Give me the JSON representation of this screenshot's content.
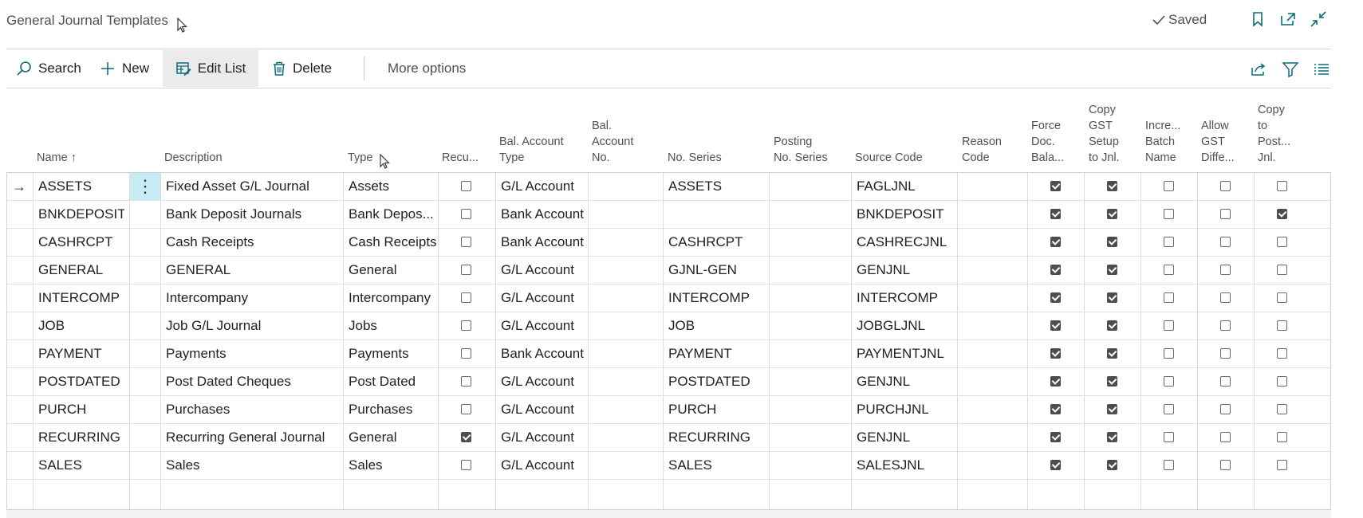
{
  "page": {
    "title": "General Journal Templates",
    "saved_label": "Saved"
  },
  "toolbar": {
    "search_label": "Search",
    "new_label": "New",
    "edit_list_label": "Edit List",
    "delete_label": "Delete",
    "more_options_label": "More options"
  },
  "icons": {
    "bookmark": "bookmark-icon",
    "open_new_window": "open-new-window-icon",
    "collapse": "collapse-icon",
    "share": "share-icon",
    "filter": "filter-icon",
    "list_view": "list-view-icon"
  },
  "colors": {
    "accent": "#0f6c7c",
    "selected_cell": "#c7ecf4",
    "active_action_bg": "#ebebeb"
  },
  "columns": {
    "name": "Name ↑",
    "description": "Description",
    "type": "Type",
    "recurring": "Recu...",
    "bal_account_type": [
      "Bal. Account",
      "Type"
    ],
    "bal_account_no": [
      "Bal.",
      "Account",
      "No."
    ],
    "no_series": "No. Series",
    "posting_no_series": [
      "Posting",
      "No. Series"
    ],
    "source_code": "Source Code",
    "reason_code": [
      "Reason",
      "Code"
    ],
    "force_doc_balance": [
      "Force",
      "Doc.",
      "Bala..."
    ],
    "copy_gst_setup": [
      "Copy",
      "GST",
      "Setup",
      "to Jnl."
    ],
    "increment_batch_name": [
      "Incre...",
      "Batch",
      "Name"
    ],
    "allow_gst_difference": [
      "Allow",
      "GST",
      "Diffe..."
    ],
    "copy_to_posted_jnl": [
      "Copy",
      "to",
      "Post...",
      "Jnl."
    ]
  },
  "rows": [
    {
      "name": "ASSETS",
      "description": "Fixed Asset G/L Journal",
      "type": "Assets",
      "recurring": false,
      "bal_account_type": "G/L Account",
      "bal_account_no": "",
      "no_series": "ASSETS",
      "posting_no_series": "",
      "source_code": "FAGLJNL",
      "reason_code": "",
      "force_doc_balance": true,
      "copy_gst_setup": true,
      "increment_batch_name": false,
      "allow_gst_difference": false,
      "copy_to_posted_jnl": false
    },
    {
      "name": "BNKDEPOSIT",
      "description": "Bank Deposit Journals",
      "type": "Bank Depos...",
      "recurring": false,
      "bal_account_type": "Bank Account",
      "bal_account_no": "",
      "no_series": "",
      "posting_no_series": "",
      "source_code": "BNKDEPOSIT",
      "reason_code": "",
      "force_doc_balance": true,
      "copy_gst_setup": true,
      "increment_batch_name": false,
      "allow_gst_difference": false,
      "copy_to_posted_jnl": true
    },
    {
      "name": "CASHRCPT",
      "description": "Cash Receipts",
      "type": "Cash Receipts",
      "recurring": false,
      "bal_account_type": "Bank Account",
      "bal_account_no": "",
      "no_series": "CASHRCPT",
      "posting_no_series": "",
      "source_code": "CASHRECJNL",
      "reason_code": "",
      "force_doc_balance": true,
      "copy_gst_setup": true,
      "increment_batch_name": false,
      "allow_gst_difference": false,
      "copy_to_posted_jnl": false
    },
    {
      "name": "GENERAL",
      "description": "GENERAL",
      "type": "General",
      "recurring": false,
      "bal_account_type": "G/L Account",
      "bal_account_no": "",
      "no_series": "GJNL-GEN",
      "posting_no_series": "",
      "source_code": "GENJNL",
      "reason_code": "",
      "force_doc_balance": true,
      "copy_gst_setup": true,
      "increment_batch_name": false,
      "allow_gst_difference": false,
      "copy_to_posted_jnl": false
    },
    {
      "name": "INTERCOMP",
      "description": "Intercompany",
      "type": "Intercompany",
      "recurring": false,
      "bal_account_type": "G/L Account",
      "bal_account_no": "",
      "no_series": "INTERCOMP",
      "posting_no_series": "",
      "source_code": "INTERCOMP",
      "reason_code": "",
      "force_doc_balance": true,
      "copy_gst_setup": true,
      "increment_batch_name": false,
      "allow_gst_difference": false,
      "copy_to_posted_jnl": false
    },
    {
      "name": "JOB",
      "description": "Job G/L Journal",
      "type": "Jobs",
      "recurring": false,
      "bal_account_type": "G/L Account",
      "bal_account_no": "",
      "no_series": "JOB",
      "posting_no_series": "",
      "source_code": "JOBGLJNL",
      "reason_code": "",
      "force_doc_balance": true,
      "copy_gst_setup": true,
      "increment_batch_name": false,
      "allow_gst_difference": false,
      "copy_to_posted_jnl": false
    },
    {
      "name": "PAYMENT",
      "description": "Payments",
      "type": "Payments",
      "recurring": false,
      "bal_account_type": "Bank Account",
      "bal_account_no": "",
      "no_series": "PAYMENT",
      "posting_no_series": "",
      "source_code": "PAYMENTJNL",
      "reason_code": "",
      "force_doc_balance": true,
      "copy_gst_setup": true,
      "increment_batch_name": false,
      "allow_gst_difference": false,
      "copy_to_posted_jnl": false
    },
    {
      "name": "POSTDATED",
      "description": "Post Dated Cheques",
      "type": "Post Dated",
      "recurring": false,
      "bal_account_type": "G/L Account",
      "bal_account_no": "",
      "no_series": "POSTDATED",
      "posting_no_series": "",
      "source_code": "GENJNL",
      "reason_code": "",
      "force_doc_balance": true,
      "copy_gst_setup": true,
      "increment_batch_name": false,
      "allow_gst_difference": false,
      "copy_to_posted_jnl": false
    },
    {
      "name": "PURCH",
      "description": "Purchases",
      "type": "Purchases",
      "recurring": false,
      "bal_account_type": "G/L Account",
      "bal_account_no": "",
      "no_series": "PURCH",
      "posting_no_series": "",
      "source_code": "PURCHJNL",
      "reason_code": "",
      "force_doc_balance": true,
      "copy_gst_setup": true,
      "increment_batch_name": false,
      "allow_gst_difference": false,
      "copy_to_posted_jnl": false
    },
    {
      "name": "RECURRING",
      "description": "Recurring General Journal",
      "type": "General",
      "recurring": true,
      "bal_account_type": "G/L Account",
      "bal_account_no": "",
      "no_series": "RECURRING",
      "posting_no_series": "",
      "source_code": "GENJNL",
      "reason_code": "",
      "force_doc_balance": true,
      "copy_gst_setup": true,
      "increment_batch_name": false,
      "allow_gst_difference": false,
      "copy_to_posted_jnl": false
    },
    {
      "name": "SALES",
      "description": "Sales",
      "type": "Sales",
      "recurring": false,
      "bal_account_type": "G/L Account",
      "bal_account_no": "",
      "no_series": "SALES",
      "posting_no_series": "",
      "source_code": "SALESJNL",
      "reason_code": "",
      "force_doc_balance": true,
      "copy_gst_setup": true,
      "increment_batch_name": false,
      "allow_gst_difference": false,
      "copy_to_posted_jnl": false
    }
  ]
}
